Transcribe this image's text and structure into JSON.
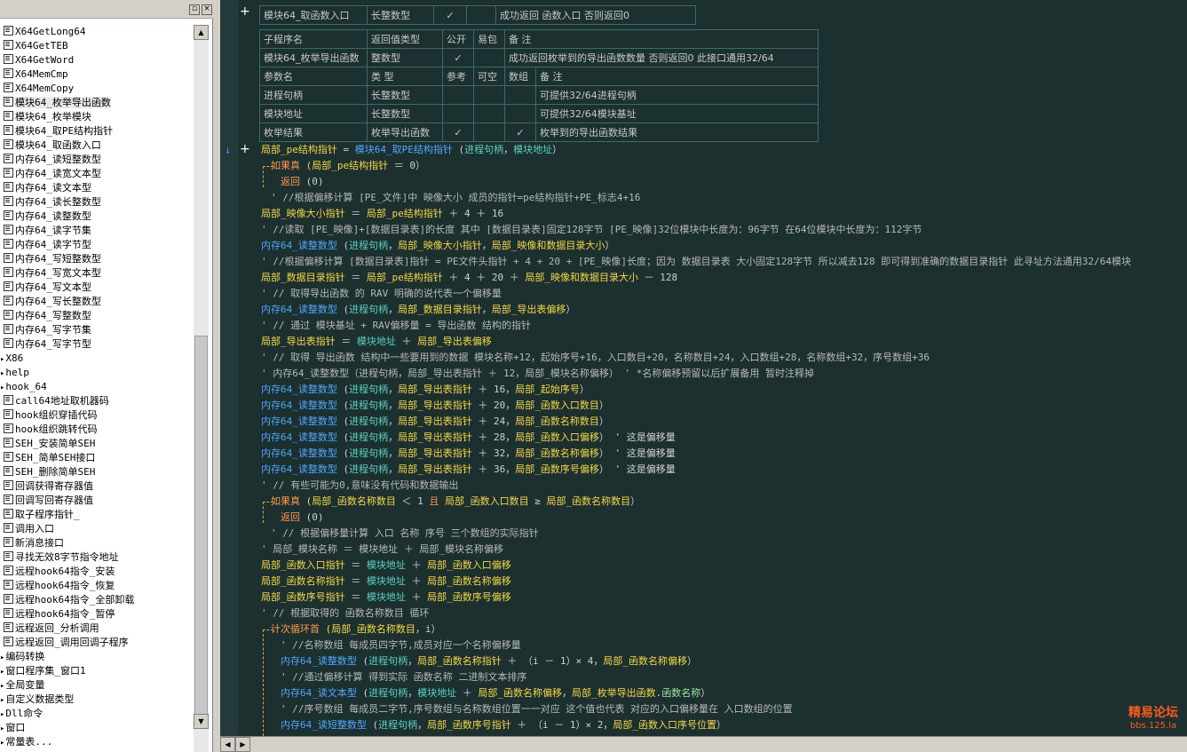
{
  "tree_items": [
    "X64GetLong64",
    "X64GetTEB",
    "X64GetWord",
    "X64MemCmp",
    "X64MemCopy",
    "模块64_枚举导出函数",
    "模块64_枚举模块",
    "模块64_取PE结构指针",
    "模块64_取函数入口",
    "内存64_读短整数型",
    "内存64_读宽文本型",
    "内存64_读文本型",
    "内存64_读长整数型",
    "内存64_读整数型",
    "内存64_读字节集",
    "内存64_读字节型",
    "内存64_写短整数型",
    "内存64_写宽文本型",
    "内存64_写文本型",
    "内存64_写长整数型",
    "内存64_写整数型",
    "内存64_写字节集",
    "内存64_写字节型",
    "X86",
    "help",
    "hook_64",
    "call64地址取机器码",
    "hook组织穿插代码",
    "hook组织跳转代码",
    "SEH_安装简单SEH",
    "SEH_简单SEH接口",
    "SEH_删除简单SEH",
    "回调获得寄存器值",
    "回调写回寄存器值",
    "取子程序指针_",
    "调用入口",
    "新消息接口",
    "寻找无效8字节指令地址",
    "远程hook64指令_安装",
    "远程hook64指令_恢复",
    "远程hook64指令_全部卸载",
    "远程hook64指令_暂停",
    "远程返回_分析调用",
    "远程返回_调用回调子程序",
    "编码转换",
    "窗口程序集_窗口1",
    "全局变量",
    "自定义数据类型",
    "Dll命令",
    "窗口",
    "常量表..."
  ],
  "top_table": [
    "模块64_取函数入口",
    "长整数型",
    "✓",
    "",
    "成功返回 函数入口 否则返回0"
  ],
  "sub_header": [
    "子程序名",
    "返回值类型",
    "公开",
    "易包",
    "备 注"
  ],
  "sub_row": [
    "模块64_枚举导出函数",
    "整数型",
    "✓",
    "",
    "成功返回枚举到的导出函数数量  否则返回0 此接口通用32/64"
  ],
  "param_header": [
    "参数名",
    "类 型",
    "参考",
    "可空",
    "数组",
    "备 注"
  ],
  "param_rows": [
    [
      "进程句柄",
      "长整数型",
      "",
      "",
      "",
      "可提供32/64进程句柄"
    ],
    [
      "模块地址",
      "长整数型",
      "",
      "",
      "",
      "可提供32/64模块基址"
    ],
    [
      "枚举结果",
      "枚举导出函数",
      "✓",
      "",
      "✓",
      "枚举到的导出函数结果"
    ]
  ],
  "code_lines": [
    {
      "i": 0,
      "s": [
        [
          "y",
          "局部_pe结构指针"
        ],
        [
          "g",
          " = "
        ],
        [
          "c",
          "模块64_取PE结构指针"
        ],
        [
          "g",
          " ("
        ],
        [
          "tn",
          "进程句柄"
        ],
        [
          "g",
          "，"
        ],
        [
          "tn",
          "模块地址"
        ],
        [
          "g",
          "）"
        ]
      ]
    },
    {
      "i": 1,
      "s": [
        [
          "ky",
          "如果真"
        ],
        [
          "y",
          " (局部_pe结构指针"
        ],
        [
          "g",
          " ＝ 0）"
        ]
      ]
    },
    {
      "i": 2,
      "s": [
        [
          "ky",
          "返回"
        ],
        [
          "g",
          " (0)"
        ]
      ]
    },
    {
      "i": 1,
      "s": [
        [
          "cm",
          "' //根据偏移计算 [PE_文件]中 映像大小 成员的指针=pe结构指针+PE_标志4+16"
        ]
      ]
    },
    {
      "i": 0,
      "s": [
        [
          "y",
          "局部_映像大小指针"
        ],
        [
          "g",
          " ＝ "
        ],
        [
          "y",
          "局部_pe结构指针"
        ],
        [
          "g",
          " ＋ 4 ＋ 16"
        ]
      ]
    },
    {
      "i": 0,
      "s": [
        [
          "cm",
          "' //读取  [PE_映像]+[数据目录表]的长度  其中 [数据目录表]固定128字节   [PE_映像]32位模块中长度为：96字节 在64位模块中长度为：112字节"
        ]
      ]
    },
    {
      "i": 0,
      "s": [
        [
          "c",
          "内存64_读整数型"
        ],
        [
          "g",
          " ("
        ],
        [
          "tn",
          "进程句柄"
        ],
        [
          "g",
          "，"
        ],
        [
          "y",
          "局部_映像大小指针"
        ],
        [
          "g",
          "，"
        ],
        [
          "y",
          "局部_映像和数据目录大小"
        ],
        [
          "g",
          "）"
        ]
      ]
    },
    {
      "i": 0,
      "s": [
        [
          "cm",
          "' //根据偏移计算 [数据目录表]指针 = PE文件头指针 + 4 + 20 + [PE_映像]长度；因为 数据目录表 大小固定128字节 所以减去128 即可得到准确的数据目录指针 此寻址方法通用32/64模块"
        ]
      ]
    },
    {
      "i": 0,
      "s": [
        [
          "y",
          "局部_数据目录指针"
        ],
        [
          "g",
          " ＝ "
        ],
        [
          "y",
          "局部_pe结构指针"
        ],
        [
          "g",
          " ＋ 4 ＋ 20 ＋ "
        ],
        [
          "y",
          "局部_映像和数据目录大小"
        ],
        [
          "g",
          " － 128"
        ]
      ]
    },
    {
      "i": 0,
      "s": [
        [
          "cm",
          "' // 取得导出函数 的 RAV 明确的说代表一个偏移量"
        ]
      ]
    },
    {
      "i": 0,
      "s": [
        [
          "c",
          "内存64_读整数型"
        ],
        [
          "g",
          " ("
        ],
        [
          "tn",
          "进程句柄"
        ],
        [
          "g",
          "，"
        ],
        [
          "y",
          "局部_数据目录指针"
        ],
        [
          "g",
          "，"
        ],
        [
          "y",
          "局部_导出表偏移"
        ],
        [
          "g",
          "）"
        ]
      ]
    },
    {
      "i": 0,
      "s": [
        [
          "cm",
          "' // 通过 模块基址 + RAV偏移量 = 导出函数 结构的指针"
        ]
      ]
    },
    {
      "i": 0,
      "s": [
        [
          "y",
          "局部_导出表指针"
        ],
        [
          "g",
          " ＝ "
        ],
        [
          "tn",
          "模块地址"
        ],
        [
          "g",
          " ＋ "
        ],
        [
          "y",
          "局部_导出表偏移"
        ]
      ]
    },
    {
      "i": 0,
      "s": [
        [
          "cm",
          "' // 取得 导出函数 结构中一些要用到的数据 模块名称+12，起始序号+16，入口数目+20，名称数目+24，入口数组+28，名称数组+32，序号数组+36"
        ]
      ]
    },
    {
      "i": 0,
      "s": [
        [
          "cm",
          "' 内存64_读整数型（进程句柄，局部_导出表指针 ＋ 12，局部_模块名称偏移） ' *名称偏移预留以后扩展备用 暂时注释掉"
        ]
      ]
    },
    {
      "i": 0,
      "s": [
        [
          "c",
          "内存64_读整数型"
        ],
        [
          "g",
          " ("
        ],
        [
          "tn",
          "进程句柄"
        ],
        [
          "g",
          "，"
        ],
        [
          "y",
          "局部_导出表指针"
        ],
        [
          "g",
          " ＋ 16，"
        ],
        [
          "y",
          "局部_起始序号"
        ],
        [
          "g",
          "）"
        ]
      ]
    },
    {
      "i": 0,
      "s": [
        [
          "c",
          "内存64_读整数型"
        ],
        [
          "g",
          " ("
        ],
        [
          "tn",
          "进程句柄"
        ],
        [
          "g",
          "，"
        ],
        [
          "y",
          "局部_导出表指针"
        ],
        [
          "g",
          " ＋ 20，"
        ],
        [
          "y",
          "局部_函数入口数目"
        ],
        [
          "g",
          "）"
        ]
      ]
    },
    {
      "i": 0,
      "s": [
        [
          "c",
          "内存64_读整数型"
        ],
        [
          "g",
          " ("
        ],
        [
          "tn",
          "进程句柄"
        ],
        [
          "g",
          "，"
        ],
        [
          "y",
          "局部_导出表指针"
        ],
        [
          "g",
          " ＋ 24，"
        ],
        [
          "y",
          "局部_函数名称数目"
        ],
        [
          "g",
          "）"
        ]
      ]
    },
    {
      "i": 0,
      "s": [
        [
          "c",
          "内存64_读整数型"
        ],
        [
          "g",
          " ("
        ],
        [
          "tn",
          "进程句柄"
        ],
        [
          "g",
          "，"
        ],
        [
          "y",
          "局部_导出表指针"
        ],
        [
          "g",
          " ＋ 28，"
        ],
        [
          "y",
          "局部_函数入口偏移"
        ],
        [
          "g",
          "）  ' 这是偏移量"
        ]
      ]
    },
    {
      "i": 0,
      "s": [
        [
          "c",
          "内存64_读整数型"
        ],
        [
          "g",
          " ("
        ],
        [
          "tn",
          "进程句柄"
        ],
        [
          "g",
          "，"
        ],
        [
          "y",
          "局部_导出表指针"
        ],
        [
          "g",
          " ＋ 32，"
        ],
        [
          "y",
          "局部_函数名称偏移"
        ],
        [
          "g",
          "）  ' 这是偏移量"
        ]
      ]
    },
    {
      "i": 0,
      "s": [
        [
          "c",
          "内存64_读整数型"
        ],
        [
          "g",
          " ("
        ],
        [
          "tn",
          "进程句柄"
        ],
        [
          "g",
          "，"
        ],
        [
          "y",
          "局部_导出表指针"
        ],
        [
          "g",
          " ＋ 36，"
        ],
        [
          "y",
          "局部_函数序号偏移"
        ],
        [
          "g",
          "）  ' 这是偏移量"
        ]
      ]
    },
    {
      "i": 0,
      "s": [
        [
          "cm",
          "' // 有些可能为0,意味没有代码和数据输出"
        ]
      ]
    },
    {
      "i": 1,
      "s": [
        [
          "ky",
          "如果真"
        ],
        [
          "y",
          " (局部_函数名称数目"
        ],
        [
          "g",
          " ＜ 1 "
        ],
        [
          "ky",
          "且"
        ],
        [
          "y",
          " 局部_函数入口数目"
        ],
        [
          "g",
          " ≥ "
        ],
        [
          "y",
          "局部_函数名称数目"
        ],
        [
          "g",
          "）"
        ]
      ]
    },
    {
      "i": 2,
      "s": [
        [
          "ky",
          "返回"
        ],
        [
          "g",
          " (0)"
        ]
      ]
    },
    {
      "i": 1,
      "s": [
        [
          "cm",
          "' // 根据偏移量计算 入口 名称 序号 三个数组的实际指针"
        ]
      ]
    },
    {
      "i": 0,
      "s": [
        [
          "cm",
          "' 局部_模块名称 ＝ 模块地址 ＋ 局部_模块名称偏移"
        ]
      ]
    },
    {
      "i": 0,
      "s": [
        [
          "y",
          "局部_函数入口指针"
        ],
        [
          "g",
          " ＝ "
        ],
        [
          "tn",
          "模块地址"
        ],
        [
          "g",
          " ＋ "
        ],
        [
          "y",
          "局部_函数入口偏移"
        ]
      ]
    },
    {
      "i": 0,
      "s": [
        [
          "y",
          "局部_函数名称指针"
        ],
        [
          "g",
          " ＝ "
        ],
        [
          "tn",
          "模块地址"
        ],
        [
          "g",
          " ＋ "
        ],
        [
          "y",
          "局部_函数名称偏移"
        ]
      ]
    },
    {
      "i": 0,
      "s": [
        [
          "y",
          "局部_函数序号指针"
        ],
        [
          "g",
          " ＝ "
        ],
        [
          "tn",
          "模块地址"
        ],
        [
          "g",
          " ＋ "
        ],
        [
          "y",
          "局部_函数序号偏移"
        ]
      ]
    },
    {
      "i": 0,
      "s": [
        [
          "cm",
          "' // 根据取得的 函数名称数目 循环"
        ]
      ]
    },
    {
      "i": 1,
      "s": [
        [
          "ky",
          "计次循环首"
        ],
        [
          "y",
          " (局部_函数名称数目"
        ],
        [
          "g",
          "，i）"
        ]
      ]
    },
    {
      "i": 2,
      "s": [
        [
          "cm",
          "' //名称数组 每成员四字节,成员对应一个名称偏移量"
        ]
      ]
    },
    {
      "i": 2,
      "s": [
        [
          "c",
          "内存64_读整数型"
        ],
        [
          "g",
          " ("
        ],
        [
          "tn",
          "进程句柄"
        ],
        [
          "g",
          "，"
        ],
        [
          "y",
          "局部_函数名称指针"
        ],
        [
          "g",
          " ＋ （i － 1）× 4，"
        ],
        [
          "y",
          "局部_函数名称偏移"
        ],
        [
          "g",
          "）"
        ]
      ]
    },
    {
      "i": 2,
      "s": [
        [
          "cm",
          "' //通过偏移计算 得到实际 函数名称 二进制文本排序"
        ]
      ]
    },
    {
      "i": 2,
      "s": [
        [
          "c",
          "内存64_读文本型"
        ],
        [
          "g",
          " ("
        ],
        [
          "tn",
          "进程句柄"
        ],
        [
          "g",
          "，"
        ],
        [
          "tn",
          "模块地址"
        ],
        [
          "g",
          " ＋ "
        ],
        [
          "y",
          "局部_函数名称偏移"
        ],
        [
          "g",
          "，"
        ],
        [
          "y",
          "局部_枚举导出函数"
        ],
        [
          "g",
          "."
        ],
        [
          "gr",
          "函数名称"
        ],
        [
          "g",
          "）"
        ]
      ]
    },
    {
      "i": 2,
      "s": [
        [
          "cm",
          "' //序号数组 每成员二字节,序号数组与名称数组位置一一对应 这个值也代表 对应的入口偏移量在 入口数组的位置"
        ]
      ]
    },
    {
      "i": 2,
      "s": [
        [
          "c",
          "内存64_读短整数型"
        ],
        [
          "g",
          " ("
        ],
        [
          "tn",
          "进程句柄"
        ],
        [
          "g",
          "，"
        ],
        [
          "y",
          "局部_函数序号指针"
        ],
        [
          "g",
          " ＋ （i － 1）× 2，"
        ],
        [
          "y",
          "局部_函数入口序号位置"
        ],
        [
          "g",
          "）"
        ]
      ]
    }
  ],
  "watermark": {
    "line1": "精易论坛",
    "line2": "bbs.125.la"
  }
}
